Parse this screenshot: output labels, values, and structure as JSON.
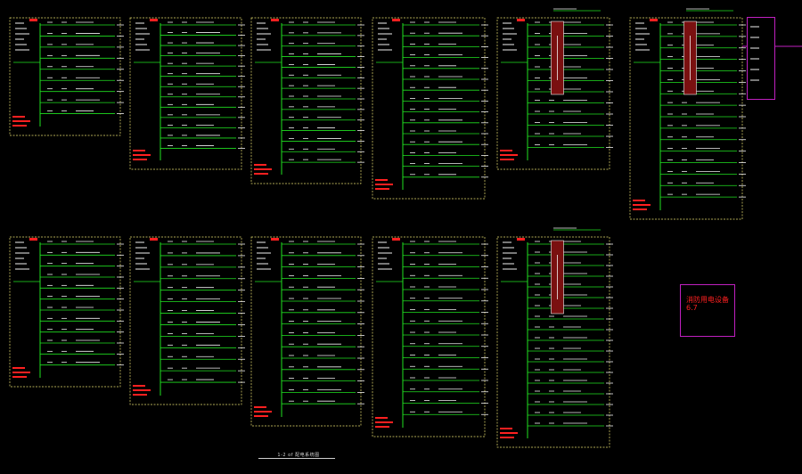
{
  "drawing": {
    "title": "1-2 of 配电系统图",
    "note_lines": [
      "消防用电设备",
      "6.7"
    ],
    "colors": {
      "background": "#000000",
      "frame": "#e8e070",
      "circuit": "#20e020",
      "text": "#f0f0f0",
      "label_red": "#ff2020",
      "device_fill": "#7a1010",
      "accent_box": "#c020c0"
    },
    "side_panel_labels": [
      "",
      "",
      "",
      "",
      "",
      ""
    ]
  }
}
